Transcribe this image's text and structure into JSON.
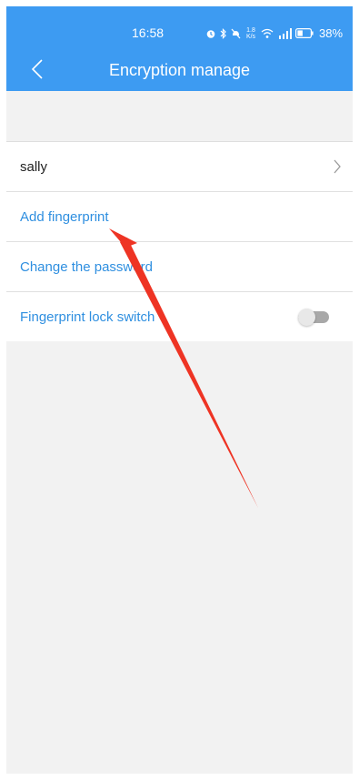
{
  "status_bar": {
    "time": "16:58",
    "network_speed": "1.8 K/s",
    "battery": "38%"
  },
  "header": {
    "back_icon": "chevron-left-icon",
    "title": "Encryption manage"
  },
  "list": {
    "user_name": "sally",
    "items": [
      {
        "label": "Add fingerprint"
      },
      {
        "label": "Change the password"
      },
      {
        "label": "Fingerprint lock switch",
        "toggle_on": false
      }
    ]
  },
  "colors": {
    "header_bg": "#3d9bf2",
    "action_text": "#2f8fe0",
    "annotation_arrow": "#ee3424"
  }
}
